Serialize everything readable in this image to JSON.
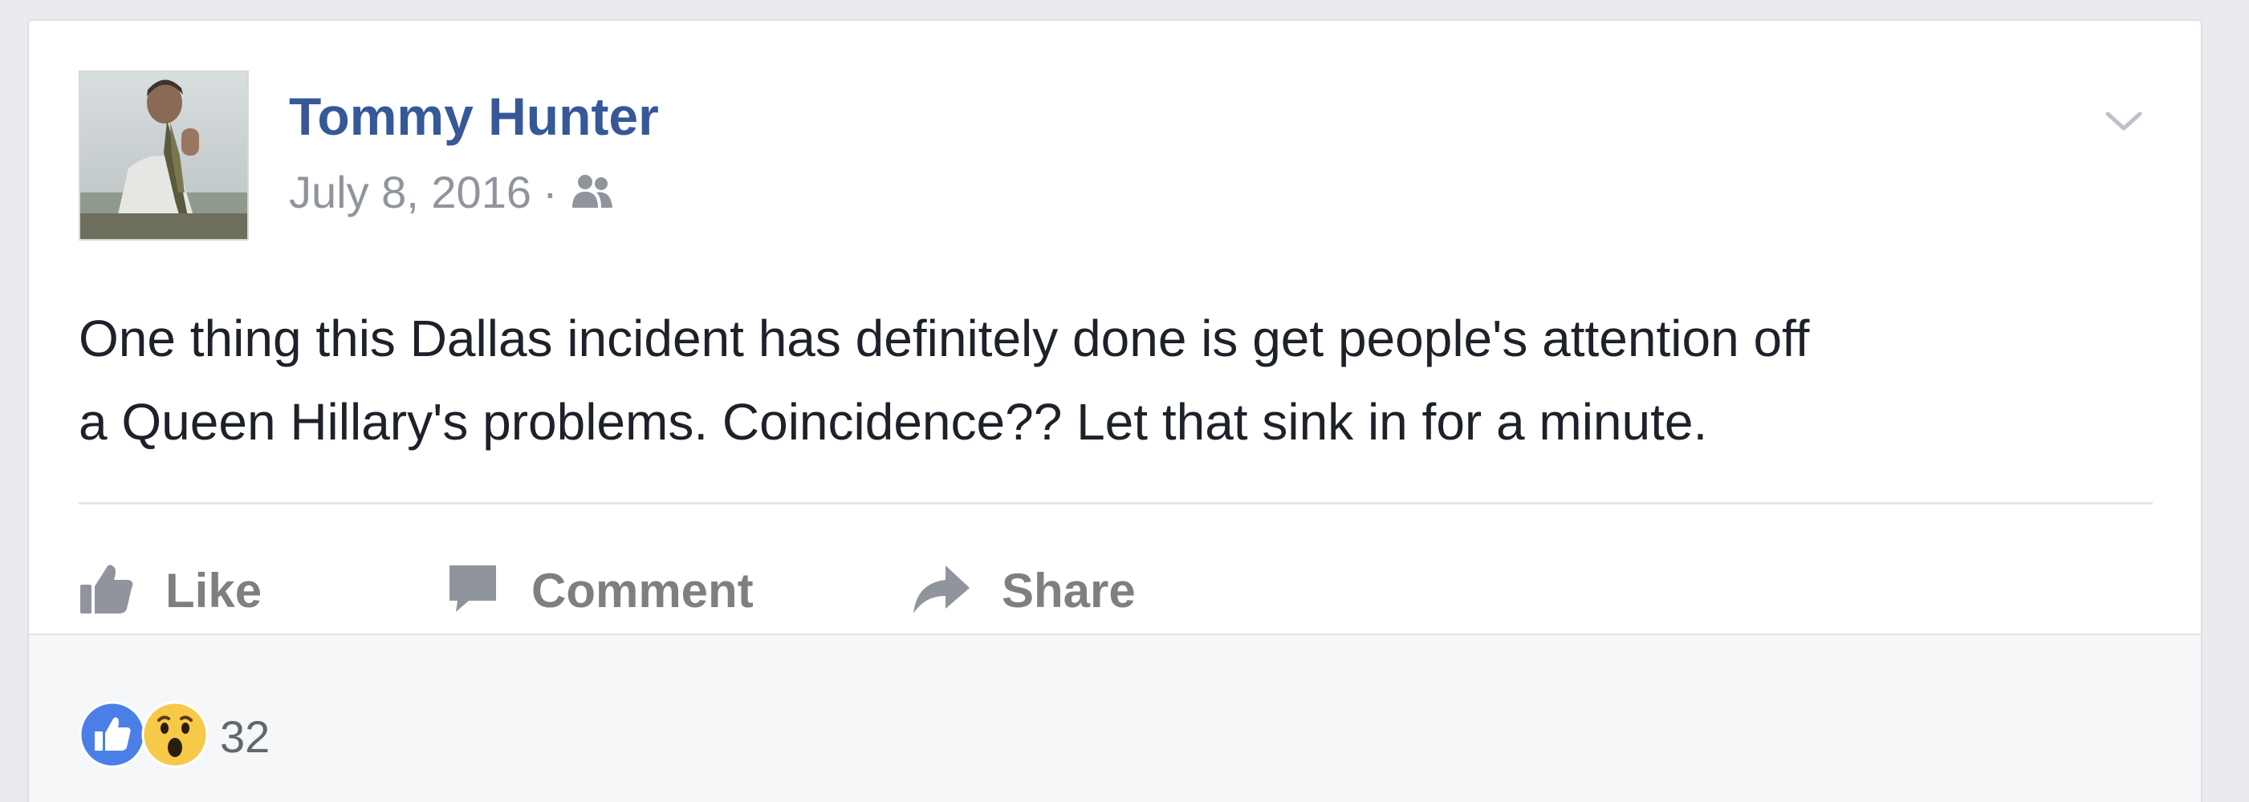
{
  "post": {
    "author": "Tommy Hunter",
    "date": "July 8, 2016",
    "separator": "·",
    "audience_icon": "friends-icon",
    "text_lines": [
      "One thing this Dallas incident has definitely done is get people's attention off",
      "a Queen Hillary's problems. Coincidence?? Let that sink in for a minute."
    ],
    "options_icon": "chevron-down-icon"
  },
  "actions": {
    "like_label": "Like",
    "comment_label": "Comment",
    "share_label": "Share"
  },
  "reactions": {
    "icons": [
      "like-reaction-icon",
      "wow-reaction-icon"
    ],
    "count": "32"
  },
  "colors": {
    "author_link": "#365899",
    "meta_text": "#90949c",
    "body_text": "#1d2129",
    "action_text": "#7f7f7f",
    "like_blue": "#4a7fe8",
    "wow_yellow": "#f7c948"
  }
}
